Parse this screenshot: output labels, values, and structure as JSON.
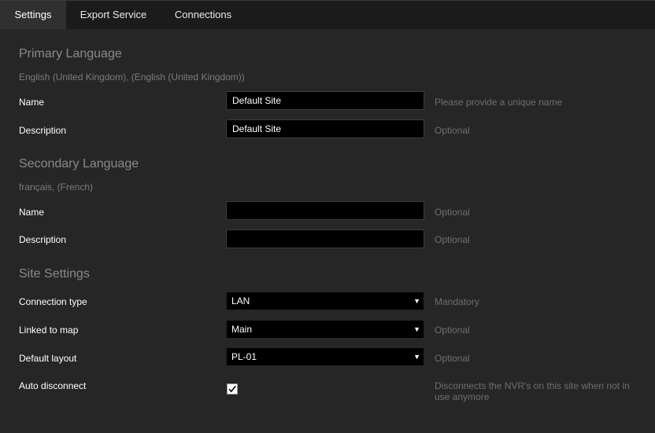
{
  "tabs": [
    {
      "label": "Settings"
    },
    {
      "label": "Export Service"
    },
    {
      "label": "Connections"
    }
  ],
  "primary": {
    "title": "Primary Language",
    "language": "English (United Kingdom), (English (United Kingdom))",
    "name_label": "Name",
    "name_value": "Default Site",
    "name_hint": "Please provide a unique name",
    "description_label": "Description",
    "description_value": "Default Site",
    "description_hint": "Optional"
  },
  "secondary": {
    "title": "Secondary Language",
    "language": "français, (French)",
    "name_label": "Name",
    "name_value": "",
    "name_hint": "Optional",
    "description_label": "Description",
    "description_value": "",
    "description_hint": "Optional"
  },
  "site": {
    "title": "Site Settings",
    "connection_type_label": "Connection type",
    "connection_type_value": "LAN",
    "connection_type_hint": "Mandatory",
    "linked_map_label": "Linked to map",
    "linked_map_value": "Main",
    "linked_map_hint": "Optional",
    "default_layout_label": "Default layout",
    "default_layout_value": "PL-01",
    "default_layout_hint": "Optional",
    "auto_disconnect_label": "Auto disconnect",
    "auto_disconnect_checked": true,
    "auto_disconnect_hint_line1": "Disconnects the NVR's on this site when not in",
    "auto_disconnect_hint_line2": "use anymore"
  },
  "colors": {
    "background": "#262626",
    "tabbar": "#1b1b1b",
    "active_tab": "#303030",
    "input_bg": "#000000",
    "section_title": "#8a8a8a",
    "hint": "#6f6f6f"
  }
}
